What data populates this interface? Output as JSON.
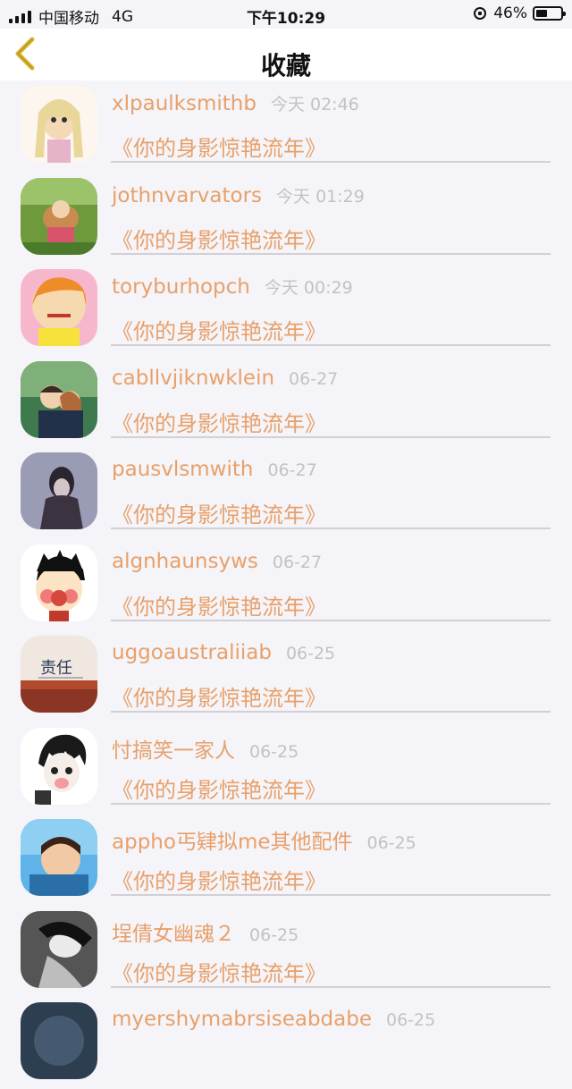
{
  "status_bar": {
    "carrier": "中国移动",
    "network": "4G",
    "time": "下午10:29",
    "battery_percent": "46%",
    "battery_level": 0.46
  },
  "nav": {
    "title": "收藏",
    "back_icon": "chevron-left-icon",
    "back_color": "#d9b22e"
  },
  "items": [
    {
      "name": "xlpaulksmithb",
      "time": "今天 02:46",
      "title": "《你的身影惊艳流年》"
    },
    {
      "name": "jothnvarvators",
      "time": "今天 01:29",
      "title": "《你的身影惊艳流年》"
    },
    {
      "name": "toryburhopch",
      "time": "今天 00:29",
      "title": "《你的身影惊艳流年》"
    },
    {
      "name": "cabllvjiknwklein",
      "time": "06-27",
      "title": "《你的身影惊艳流年》"
    },
    {
      "name": "pausvlsmwith",
      "time": "06-27",
      "title": "《你的身影惊艳流年》"
    },
    {
      "name": "algnhaunsyws",
      "time": "06-27",
      "title": "《你的身影惊艳流年》"
    },
    {
      "name": "uggoaustraliiab",
      "time": "06-25",
      "title": "《你的身影惊艳流年》"
    },
    {
      "name": "忖搞笑一家人",
      "time": "06-25",
      "title": "《你的身影惊艳流年》"
    },
    {
      "name": "appho丐肄拟me其他配件",
      "time": "06-25",
      "title": "《你的身影惊艳流年》"
    },
    {
      "name": "埕倩女幽魂２",
      "time": "06-25",
      "title": "《你的身影惊艳流年》"
    },
    {
      "name": "myershymabrsiseabdabe",
      "time": "06-25",
      "title": ""
    }
  ],
  "colors": {
    "accent": "#e8a06a",
    "muted": "#c3c1c6",
    "background": "#f5f4f8",
    "divider": "#d2d0d4"
  }
}
